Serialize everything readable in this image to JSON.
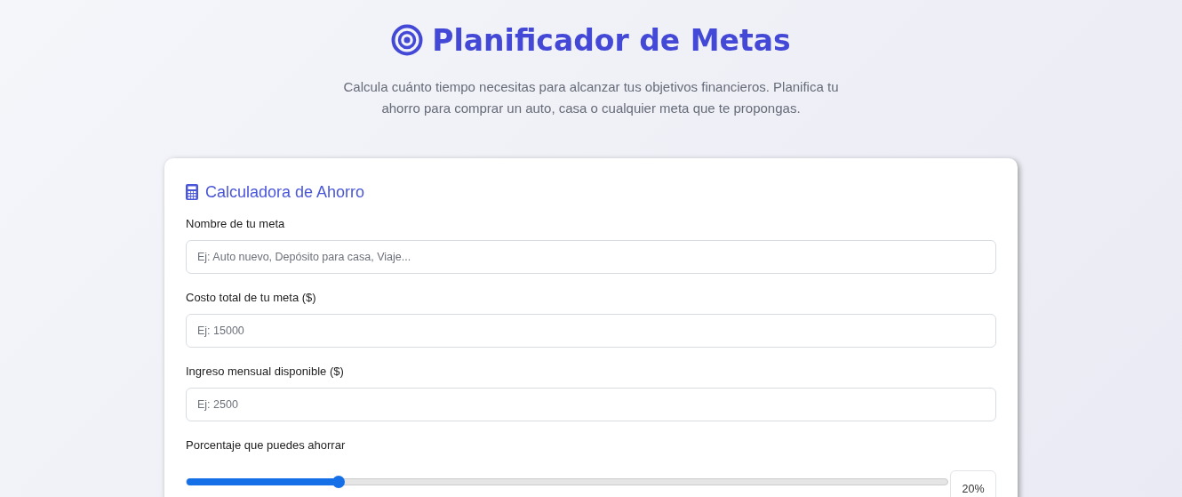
{
  "header": {
    "title": "Planificador de Metas",
    "subtitle": "Calcula cuánto tiempo necesitas para alcanzar tus objetivos financieros. Planifica tu ahorro para comprar un auto, casa o cualquier meta que te propongas."
  },
  "calculator": {
    "title": "Calculadora de Ahorro",
    "fields": [
      {
        "kind": "text",
        "label": "Nombre de tu meta",
        "placeholder": "Ej: Auto nuevo, Depósito para casa, Viaje..."
      },
      {
        "kind": "text",
        "label": "Costo total de tu meta ($)",
        "placeholder": "Ej: 15000"
      },
      {
        "kind": "text",
        "label": "Ingreso mensual disponible ($)",
        "placeholder": "Ej: 2500"
      },
      {
        "kind": "slider",
        "label": "Porcentaje que puedes ahorrar",
        "level": 0.2,
        "reading": "20%"
      }
    ]
  }
}
